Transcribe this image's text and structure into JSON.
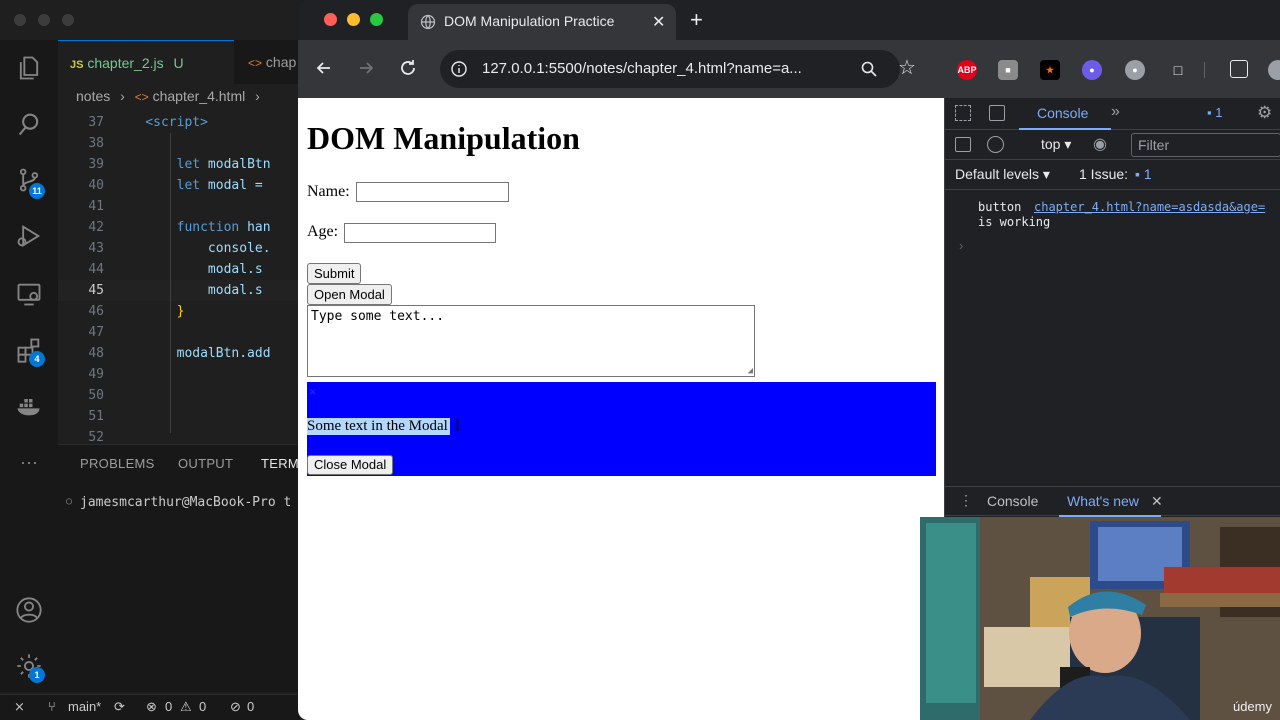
{
  "vscode": {
    "tabs": [
      {
        "icon": "JS",
        "label": "chapter_2.js",
        "status": "U"
      },
      {
        "icon": "<>",
        "label": "chap"
      }
    ],
    "breadcrumb": {
      "folder": "notes",
      "file": "chapter_4.html"
    },
    "code_lines": [
      {
        "n": "37",
        "text": "    <script>"
      },
      {
        "n": "38",
        "text": ""
      },
      {
        "n": "39",
        "text": "        let modalBtn"
      },
      {
        "n": "40",
        "text": "        let modal = "
      },
      {
        "n": "41",
        "text": ""
      },
      {
        "n": "42",
        "text": "        function han"
      },
      {
        "n": "43",
        "text": "            console."
      },
      {
        "n": "44",
        "text": "            modal.s"
      },
      {
        "n": "45",
        "text": "            modal.s"
      },
      {
        "n": "46",
        "text": "        }"
      },
      {
        "n": "47",
        "text": ""
      },
      {
        "n": "48",
        "text": "        modalBtn.add"
      },
      {
        "n": "49",
        "text": ""
      },
      {
        "n": "50",
        "text": ""
      },
      {
        "n": "51",
        "text": ""
      },
      {
        "n": "52",
        "text": ""
      }
    ],
    "panel_tabs": [
      "PROBLEMS",
      "OUTPUT",
      "TERMI"
    ],
    "terminal_line": "jamesmcarthur@MacBook-Pro t",
    "activity_badges": {
      "source_control": "11",
      "extensions": "4",
      "settings": "1"
    },
    "status": {
      "branch": "main*",
      "errors": "0",
      "warnings": "0",
      "ports": "0"
    }
  },
  "chrome": {
    "tab_title": "DOM Manipulation Practice",
    "url": "127.0.0.1:5500/notes/chapter_4.html?name=a...",
    "extensions": [
      "ABP",
      "■",
      "★",
      "●",
      "●",
      "□"
    ],
    "page": {
      "heading": "DOM Manipulation",
      "name_label": "Name:",
      "age_label": "Age:",
      "submit_label": "Submit",
      "open_modal_label": "Open Modal",
      "textarea_placeholder": "Type some text...",
      "modal_close_glyph": "×",
      "modal_text": "Some text in the Modal",
      "close_modal_label": "Close Modal"
    },
    "devtools": {
      "tab_console": "Console",
      "issues_badge": "1",
      "context": "top",
      "filter_placeholder": "Filter",
      "levels": "Default levels",
      "issues_label": "1 Issue:",
      "issues_count": "1",
      "log_text": "button",
      "log_link": "chapter_4.html?name=asdasda&age=",
      "log_text2": "is working",
      "drawer_console": "Console",
      "drawer_whats_new": "What's new"
    }
  },
  "webcam": {
    "watermark": "údemy"
  },
  "colors": {
    "vscode_bg": "#1f1f1f",
    "accent": "#0078d4",
    "modal_blue": "#0000ff",
    "selection": "#b3d7ff",
    "devtools_accent": "#7cacf8"
  }
}
